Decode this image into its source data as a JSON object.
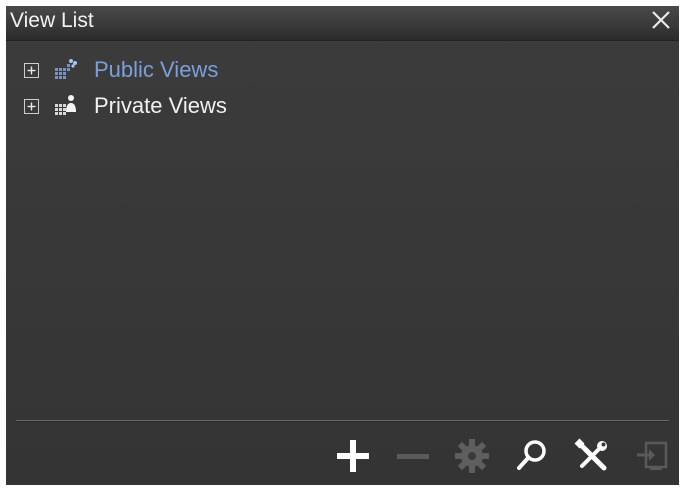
{
  "window": {
    "title": "View List"
  },
  "tree": {
    "items": [
      {
        "label": "Public Views",
        "selected": true,
        "icon": "public-views-icon"
      },
      {
        "label": "Private Views",
        "selected": false,
        "icon": "private-views-icon"
      }
    ]
  },
  "toolbar": {
    "buttons": [
      {
        "name": "add",
        "icon": "plus-icon",
        "enabled": true
      },
      {
        "name": "remove",
        "icon": "minus-icon",
        "enabled": false
      },
      {
        "name": "settings",
        "icon": "gear-icon",
        "enabled": false
      },
      {
        "name": "search",
        "icon": "magnifier-icon",
        "enabled": true
      },
      {
        "name": "tools",
        "icon": "tools-icon",
        "enabled": true
      },
      {
        "name": "apply",
        "icon": "enter-screen-icon",
        "enabled": false
      }
    ]
  },
  "colors": {
    "panel_bg": "#383838",
    "selected_text": "#7b9fd8",
    "text": "#f0f0f0",
    "enabled_icon": "#ffffff",
    "disabled_icon": "#5a5a5a"
  }
}
